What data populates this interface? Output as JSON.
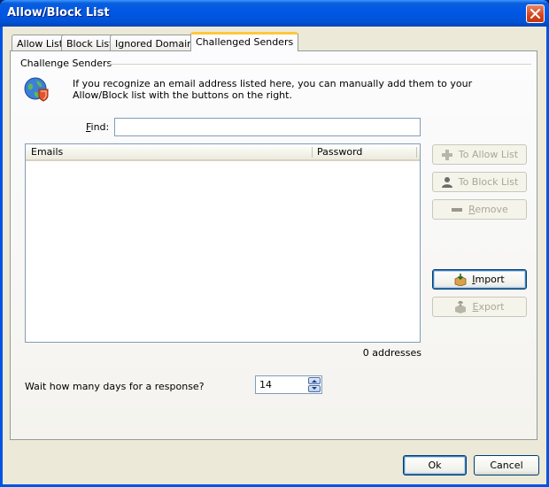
{
  "window": {
    "title": "Allow/Block List"
  },
  "tabs": [
    {
      "label": "Allow List"
    },
    {
      "label": "Block List"
    },
    {
      "label": "Ignored Domains"
    },
    {
      "label": "Challenged Senders"
    }
  ],
  "section": {
    "title": "Challenge Senders",
    "info_text": "If you recognize an email address listed here, you can manually add them to your Allow/Block list with the buttons on the right."
  },
  "find": {
    "label_prefix": "F",
    "label_rest": "ind:",
    "value": ""
  },
  "list": {
    "columns": [
      "Emails",
      "Password"
    ],
    "rows": [],
    "count_text": "0 addresses"
  },
  "side_buttons": {
    "to_allow": "To Allow List",
    "to_block": "To Block List",
    "remove": "Remove",
    "import": "Import",
    "export": "Export"
  },
  "wait": {
    "label": "Wait how many days for a response?",
    "value": "14"
  },
  "footer": {
    "ok": "Ok",
    "cancel": "Cancel"
  }
}
